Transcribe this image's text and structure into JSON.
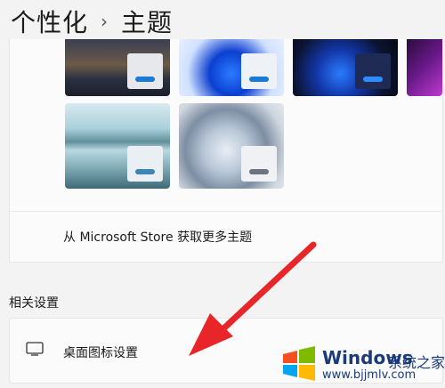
{
  "breadcrumb": {
    "parent": "个性化",
    "separator": "›",
    "current": "主题"
  },
  "themes": {
    "store_link": "从 Microsoft Store 获取更多主题"
  },
  "related_settings": {
    "heading": "相关设置",
    "desktop_icon_settings": "桌面图标设置"
  },
  "watermark": {
    "brand": "Windows",
    "suffix": "系统之家",
    "url": "www.bjjmlv.com"
  },
  "colors": {
    "accent_red": "#e8262a",
    "taskbar_blue": "#1d79d6"
  }
}
